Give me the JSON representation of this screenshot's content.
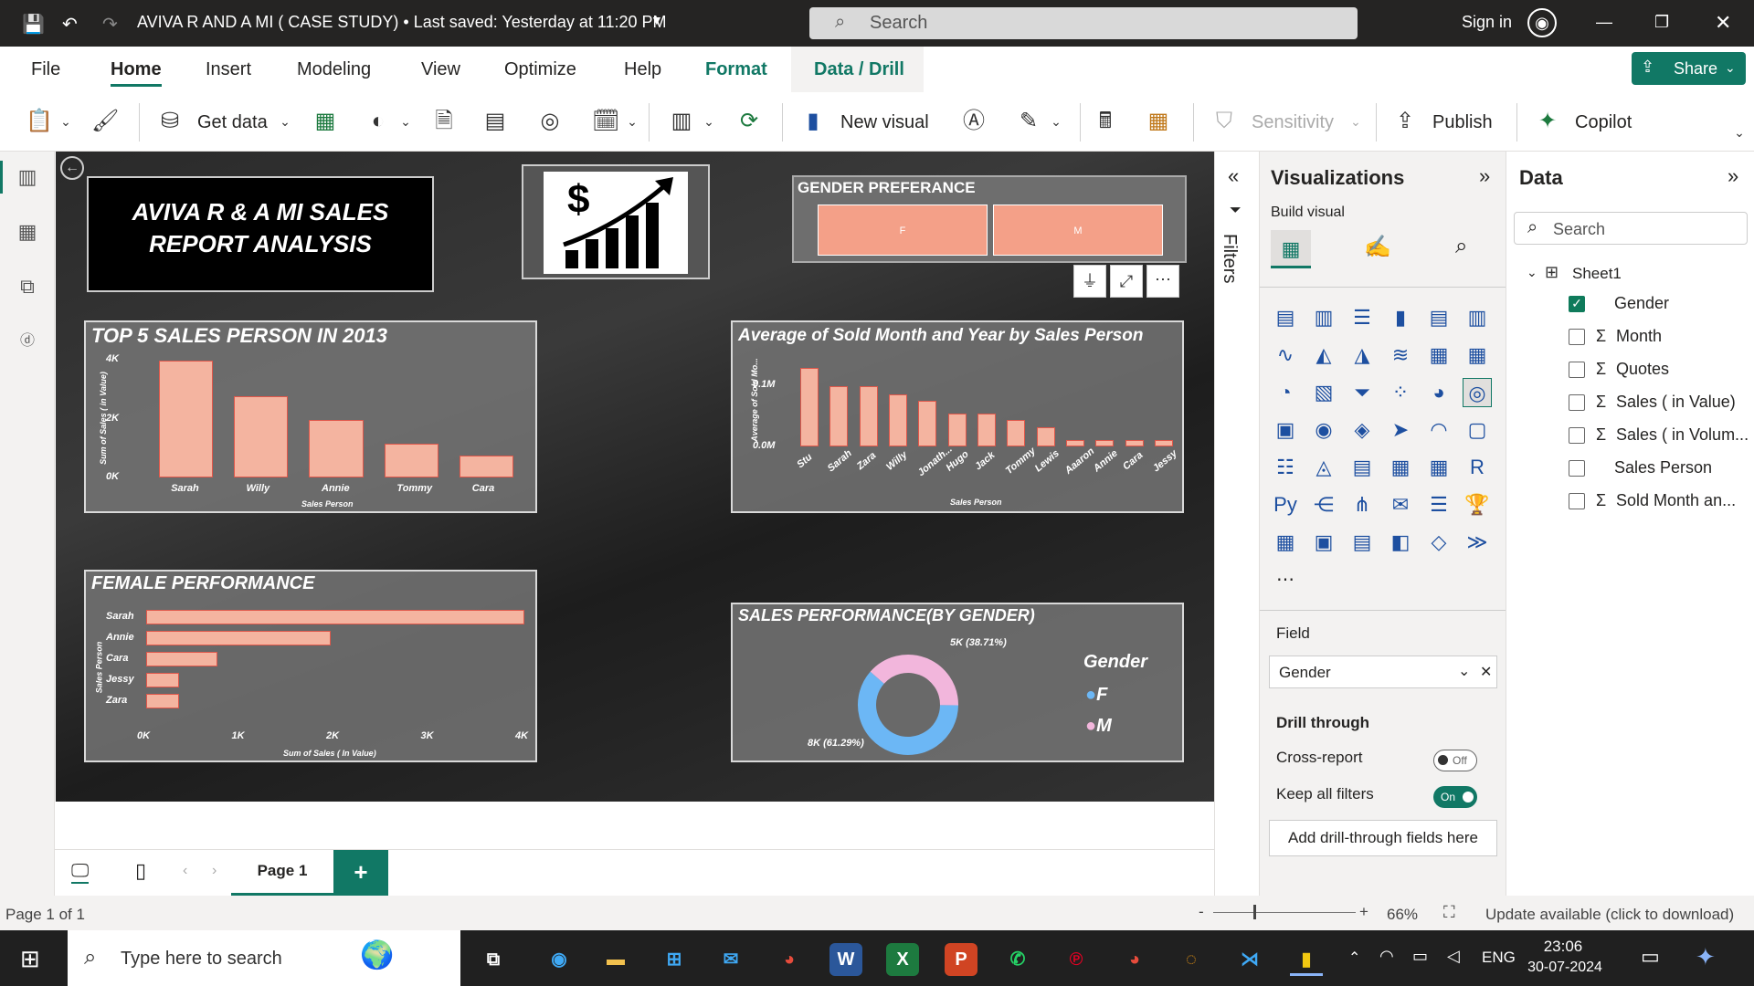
{
  "titlebar": {
    "title": "AVIVA R AND A MI ( CASE STUDY)  •  Last saved: Yesterday at 11:20 PM",
    "search_placeholder": "Search",
    "signin": "Sign in"
  },
  "menu": {
    "file": "File",
    "home": "Home",
    "insert": "Insert",
    "modeling": "Modeling",
    "view": "View",
    "optimize": "Optimize",
    "help": "Help",
    "format": "Format",
    "data_drill": "Data / Drill",
    "share": "Share"
  },
  "ribbon": {
    "get_data": "Get data",
    "new_visual": "New visual",
    "sensitivity": "Sensitivity",
    "publish": "Publish",
    "copilot": "Copilot"
  },
  "report": {
    "title_line1": "AVIVA R & A MI SALES",
    "title_line2": "REPORT ANALYSIS",
    "gender_pref": {
      "title": "GENDER PREFERANCE",
      "items": [
        "F",
        "M"
      ]
    },
    "top5": {
      "title": "TOP 5 SALES PERSON IN 2013",
      "xlabel": "Sales Person",
      "ylabel": "Sum of Sales ( in Value)",
      "yticks": [
        "4K",
        "2K",
        "0K"
      ]
    },
    "avg_sold": {
      "title": "Average of Sold Month and Year by Sales Person",
      "xlabel": "Sales Person",
      "ylabel": "Average of Sold Mo...",
      "yticks": [
        "0.1M",
        "0.0M"
      ]
    },
    "female": {
      "title": "FEMALE PERFORMANCE",
      "xlabel": "Sum of Sales ( In Value)",
      "ylabel": "Sales Person",
      "xticks": [
        "0K",
        "1K",
        "2K",
        "3K",
        "4K"
      ]
    },
    "gender_perf": {
      "title": "SALES PERFORMANCE(BY GENDER)",
      "legend_title": "Gender",
      "legend": [
        "F",
        "M"
      ],
      "label_m": "5K (38.71%)",
      "label_f": "8K (61.29%)"
    }
  },
  "chart_data": [
    {
      "type": "bar",
      "title": "TOP 5 SALES PERSON IN 2013",
      "categories": [
        "Sarah",
        "Willy",
        "Annie",
        "Tommy",
        "Cara"
      ],
      "values": [
        3950,
        2750,
        1950,
        1150,
        750
      ],
      "xlabel": "Sales Person",
      "ylabel": "Sum of Sales ( in Value)",
      "ylim": [
        0,
        4000
      ]
    },
    {
      "type": "bar",
      "title": "Average of Sold Month and Year by Sales Person",
      "categories": [
        "Stu",
        "Sarah",
        "Zara",
        "Willy",
        "Jonath...",
        "Hugo",
        "Jack",
        "Tommy",
        "Lewis",
        "Aaaron",
        "Annie",
        "Cara",
        "Jessy"
      ],
      "values": [
        0.12,
        0.092,
        0.092,
        0.08,
        0.07,
        0.05,
        0.05,
        0.04,
        0.03,
        0.01,
        0.01,
        0.01,
        0.01
      ],
      "xlabel": "Sales Person",
      "ylabel": "Average of Sold Mo...",
      "ylim": [
        0,
        0.12
      ]
    },
    {
      "type": "bar",
      "title": "FEMALE PERFORMANCE",
      "categories": [
        "Sarah",
        "Annie",
        "Cara",
        "Jessy",
        "Zara"
      ],
      "values": [
        4000,
        1950,
        750,
        350,
        350
      ],
      "xlabel": "Sum of Sales ( In Value)",
      "ylabel": "Sales Person",
      "xlim": [
        0,
        4000
      ]
    },
    {
      "type": "pie",
      "title": "SALES PERFORMANCE(BY GENDER)",
      "categories": [
        "F",
        "M"
      ],
      "values": [
        61.29,
        38.71
      ],
      "labels": [
        "8K (61.29%)",
        "5K (38.71%)"
      ],
      "colors": [
        "#6cb7f5",
        "#f2b6dc"
      ]
    }
  ],
  "filters_label": "Filters",
  "viz": {
    "title": "Visualizations",
    "build": "Build visual",
    "field_label": "Field",
    "field_value": "Gender",
    "drill": "Drill through",
    "cross": "Cross-report",
    "cross_state": "Off",
    "keep": "Keep all filters",
    "keep_state": "On",
    "add_drill": "Add drill-through fields here"
  },
  "data": {
    "title": "Data",
    "search_placeholder": "Search",
    "table": "Sheet1",
    "fields": [
      "Gender",
      "Month",
      "Quotes",
      "Sales ( in Value)",
      "Sales ( in Volum...",
      "Sales Person",
      "Sold Month an..."
    ]
  },
  "pages": {
    "page1": "Page 1",
    "add": "+"
  },
  "status": {
    "page": "Page 1 of 1",
    "zoom": "66%",
    "update": "Update available (click to download)"
  },
  "taskbar": {
    "search": "Type here to search",
    "time": "23:06",
    "date": "30-07-2024",
    "lang": "ENG"
  },
  "colors": {
    "bar_fill": "#f4b4a0",
    "bar_stroke": "#e0574a",
    "accent": "#117865",
    "donut_f": "#6cb7f5",
    "donut_m": "#f2b6dc"
  }
}
